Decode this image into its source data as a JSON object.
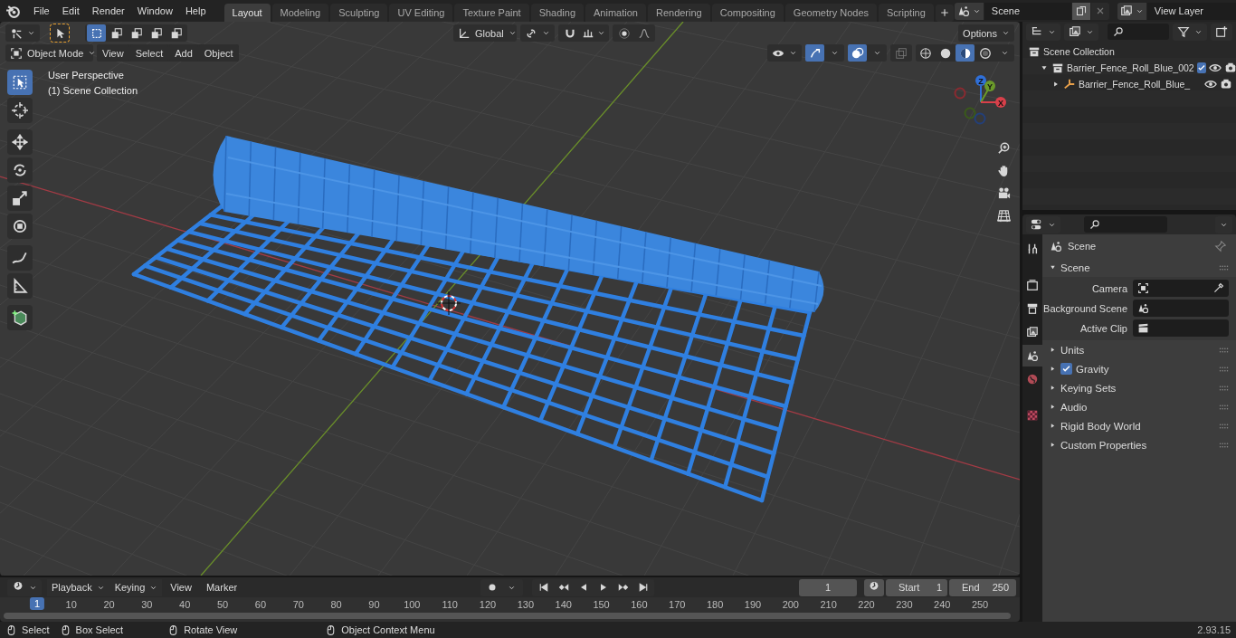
{
  "menu_bar": {
    "menus": [
      "File",
      "Edit",
      "Render",
      "Window",
      "Help"
    ]
  },
  "workspace_tabs": [
    {
      "label": "Layout",
      "selected": true
    },
    {
      "label": "Modeling",
      "selected": false
    },
    {
      "label": "Sculpting",
      "selected": false
    },
    {
      "label": "UV Editing",
      "selected": false
    },
    {
      "label": "Texture Paint",
      "selected": false
    },
    {
      "label": "Shading",
      "selected": false
    },
    {
      "label": "Animation",
      "selected": false
    },
    {
      "label": "Rendering",
      "selected": false
    },
    {
      "label": "Compositing",
      "selected": false
    },
    {
      "label": "Geometry Nodes",
      "selected": false
    },
    {
      "label": "Scripting",
      "selected": false
    }
  ],
  "scene_selector": {
    "value": "Scene"
  },
  "view_layer_selector": {
    "value": "View Layer"
  },
  "tool_settings": {
    "select_modes": [
      {
        "selected": true
      },
      {
        "selected": false
      },
      {
        "selected": false
      },
      {
        "selected": false
      },
      {
        "selected": false
      }
    ],
    "orientation": "Global",
    "options": "Options"
  },
  "viewport_header": {
    "mode": "Object Mode",
    "menus": [
      "View",
      "Select",
      "Add",
      "Object"
    ],
    "gizmo_toggle": {
      "on": true
    },
    "overlay_toggle": {
      "on": true
    },
    "shading_modes": [
      {
        "selected": false
      },
      {
        "selected": false
      },
      {
        "selected": true
      },
      {
        "selected": false
      }
    ]
  },
  "viewport": {
    "overlay_text": [
      "User Perspective",
      "(1) Scene Collection"
    ],
    "tools": [
      {
        "selected": true
      },
      {
        "selected": false
      },
      {
        "selected": false
      },
      {
        "selected": false
      },
      {
        "selected": false
      },
      {
        "selected": false
      },
      {
        "selected": false
      },
      {
        "selected": false
      },
      {
        "selected": false
      }
    ],
    "gizmo_axes": [
      "Z",
      "Y",
      "X"
    ]
  },
  "outliner": {
    "tree": [
      {
        "label": "Scene Collection",
        "children": [
          {
            "label": "Barrier_Fence_Roll_Blue_002",
            "expanded": true,
            "checked": true,
            "children": [
              {
                "label": "Barrier_Fence_Roll_Blue_",
                "expanded": false
              }
            ]
          }
        ]
      }
    ]
  },
  "properties": {
    "tabs": [
      {
        "selected": false
      },
      {
        "selected": false
      },
      {
        "selected": false
      },
      {
        "selected": false
      },
      {
        "selected": true
      },
      {
        "selected": false
      },
      {
        "selected": false
      }
    ],
    "context": "Scene",
    "panels": [
      {
        "label": "Scene",
        "expanded": true,
        "fields": [
          {
            "label": "Camera"
          },
          {
            "label": "Background Scene"
          },
          {
            "label": "Active Clip"
          }
        ]
      },
      {
        "label": "Units",
        "expanded": false
      },
      {
        "label": "Gravity",
        "expanded": false,
        "checked": true
      },
      {
        "label": "Keying Sets",
        "expanded": false
      },
      {
        "label": "Audio",
        "expanded": false
      },
      {
        "label": "Rigid Body World",
        "expanded": false
      },
      {
        "label": "Custom Properties",
        "expanded": false
      }
    ]
  },
  "timeline": {
    "menus": [
      "Playback",
      "Keying",
      "View",
      "Marker"
    ],
    "current_frame": "1",
    "start_label": "Start",
    "start": "1",
    "end_label": "End",
    "end": "250",
    "ruler": [
      {
        "label": "1",
        "selected": true
      },
      {
        "label": "10",
        "selected": false
      },
      {
        "label": "20",
        "selected": false
      },
      {
        "label": "30",
        "selected": false
      },
      {
        "label": "40",
        "selected": false
      },
      {
        "label": "50",
        "selected": false
      },
      {
        "label": "60",
        "selected": false
      },
      {
        "label": "70",
        "selected": false
      },
      {
        "label": "80",
        "selected": false
      },
      {
        "label": "90",
        "selected": false
      },
      {
        "label": "100",
        "selected": false
      },
      {
        "label": "110",
        "selected": false
      },
      {
        "label": "120",
        "selected": false
      },
      {
        "label": "130",
        "selected": false
      },
      {
        "label": "140",
        "selected": false
      },
      {
        "label": "150",
        "selected": false
      },
      {
        "label": "160",
        "selected": false
      },
      {
        "label": "170",
        "selected": false
      },
      {
        "label": "180",
        "selected": false
      },
      {
        "label": "190",
        "selected": false
      },
      {
        "label": "200",
        "selected": false
      },
      {
        "label": "210",
        "selected": false
      },
      {
        "label": "220",
        "selected": false
      },
      {
        "label": "230",
        "selected": false
      },
      {
        "label": "240",
        "selected": false
      },
      {
        "label": "250",
        "selected": false
      }
    ]
  },
  "status_bar": {
    "hints": [
      "Select",
      "Box Select",
      "Rotate View",
      "Object Context Menu"
    ],
    "version": "2.93.15"
  }
}
